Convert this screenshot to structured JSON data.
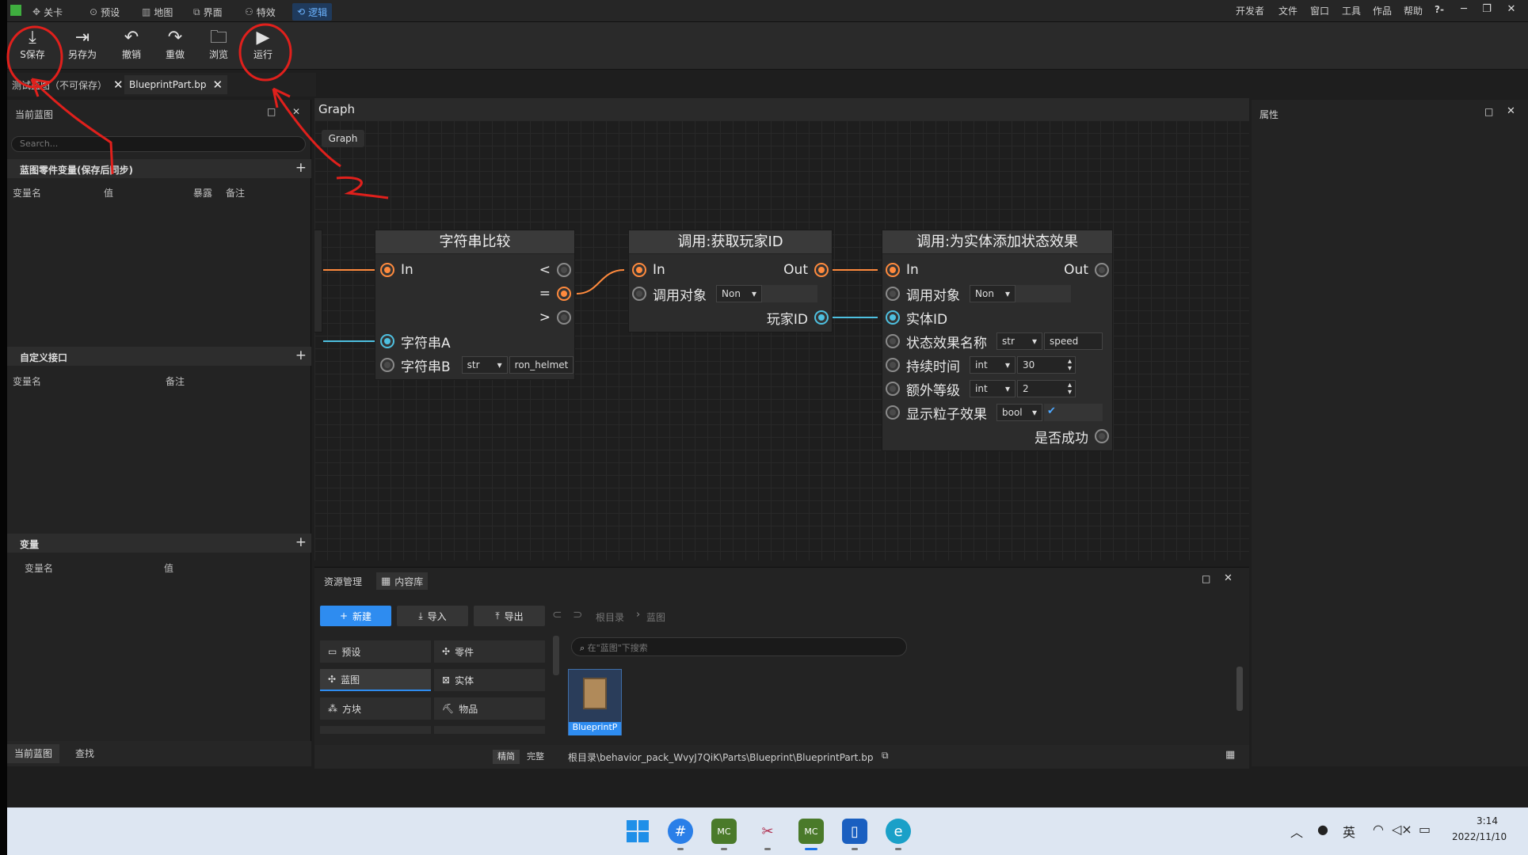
{
  "menubar": {
    "items": [
      {
        "label": "关卡",
        "icon": "level-icon"
      },
      {
        "label": "预设",
        "icon": "preset-icon"
      },
      {
        "label": "地图",
        "icon": "map-icon"
      },
      {
        "label": "界面",
        "icon": "ui-icon"
      },
      {
        "label": "特效",
        "icon": "effects-icon"
      },
      {
        "label": "逻辑",
        "icon": "logic-icon",
        "active": true
      }
    ],
    "right_items": [
      "开发者",
      "文件",
      "窗口",
      "工具",
      "作品",
      "帮助"
    ],
    "help_glyph": "?-"
  },
  "toolbar": {
    "save": "S保存",
    "save_as": "另存为",
    "undo": "撤销",
    "redo": "重做",
    "browse": "浏览",
    "run": "运行"
  },
  "tabs": {
    "tab1": "测试蓝图（不可保存）",
    "tab2": "BlueprintPart.bp"
  },
  "left_panel": {
    "title": "当前蓝图",
    "search_placeholder": "Search...",
    "section1": {
      "title": "蓝图零件变量(保存后同步)",
      "cols": [
        "变量名",
        "值",
        "暴露",
        "备注"
      ]
    },
    "section2": {
      "title": "自定义接口",
      "cols": [
        "变量名",
        "备注"
      ]
    },
    "section3": {
      "title": "变量",
      "cols": [
        "变量名",
        "值"
      ]
    },
    "bottom_tabs": [
      "当前蓝图",
      "查找"
    ]
  },
  "graph": {
    "header": "Graph",
    "chip": "Graph",
    "node1": {
      "title": "字符串比较",
      "in": "In",
      "lt": "<",
      "eq": "=",
      "gt": ">",
      "a": "字符串A",
      "b": "字符串B",
      "b_type": "str",
      "b_value": "ron_helmet"
    },
    "node2": {
      "title": "调用:获取玩家ID",
      "in": "In",
      "out": "Out",
      "target": "调用对象",
      "target_value": "Non",
      "player_id": "玩家ID"
    },
    "node3": {
      "title": "调用:为实体添加状态效果",
      "in": "In",
      "out": "Out",
      "target": "调用对象",
      "target_value": "Non",
      "entity_id": "实体ID",
      "effect_name": "状态效果名称",
      "effect_type": "str",
      "effect_value": "speed",
      "duration": "持续时间",
      "duration_type": "int",
      "duration_value": "30",
      "level": "额外等级",
      "level_type": "int",
      "level_value": "2",
      "particles": "显示粒子效果",
      "particles_type": "bool",
      "success": "是否成功"
    }
  },
  "right_panel": {
    "title": "属性"
  },
  "assets": {
    "tab1": "资源管理",
    "tab2": "内容库",
    "new": "新建",
    "import": "导入",
    "export": "导出",
    "breadcrumb_root": "根目录",
    "breadcrumb_child": "蓝图",
    "search_placeholder": "在\"蓝图\"下搜索",
    "categories": [
      "预设",
      "零件",
      "蓝图",
      "实体",
      "方块",
      "物品"
    ],
    "file_name": "BlueprintP",
    "view_simple": "精简",
    "view_full": "完整",
    "path": "根目录\\behavior_pack_WvyJ7QiK\\Parts\\Blueprint\\BlueprintPart.bp"
  },
  "taskbar": {
    "time": "3:14",
    "date": "2022/11/10",
    "ime": "英"
  },
  "colors": {
    "accent": "#2e8cf0",
    "annotation": "#e0201c",
    "exec_pin": "#ff8a3d",
    "data_pin": "#4ec0e0"
  }
}
